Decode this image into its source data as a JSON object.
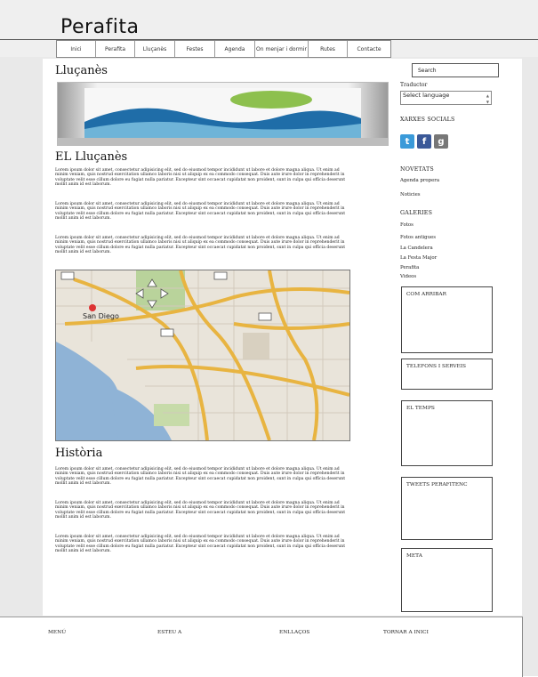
{
  "site": {
    "title": "Perafita"
  },
  "nav": {
    "items": [
      {
        "label": "Inici"
      },
      {
        "label": "Perafita"
      },
      {
        "label": "Lluçanès"
      },
      {
        "label": "Festes"
      },
      {
        "label": "Agenda"
      },
      {
        "label": "On menjar i dormir"
      },
      {
        "label": "Rutes"
      },
      {
        "label": "Contacte"
      }
    ]
  },
  "main": {
    "heading": "Lluçanès",
    "section1_title": "EL Lluçanès",
    "section2_title": "Història",
    "lorem": "Lorem ipsum dolor sit amet, consectetur adipisicing elit, sed do eiusmod tempor incididunt ut labore et dolore magna aliqua. Ut enim ad minim veniam, quis nostrud exercitation ullamco laboris nisi ut aliquip ex ea commodo consequat. Duis aute irure dolor in reprehenderit in voluptate velit esse cillum dolore eu fugiat nulla pariatur. Excepteur sint occaecat cupidatat non proident, sunt in culpa qui officia deserunt mollit anim id est laborum."
  },
  "map": {
    "city_label": "San Diego"
  },
  "sidebar": {
    "search_placeholder": "Search",
    "translator_label": "Traductor",
    "language_select": "Select language",
    "social_title": "XARXES SOCIALS",
    "social": [
      {
        "icon": "twitter-icon",
        "color": "#3a9ad9"
      },
      {
        "icon": "facebook-icon",
        "color": "#3b5998"
      },
      {
        "icon": "google-plus-icon",
        "color": "#777777"
      }
    ],
    "news_title": "NOVETATS",
    "news_items": [
      "Agenda propera",
      "Noticies"
    ],
    "galleries_title": "GALERIES",
    "gallery_items": [
      "Fotos",
      "Fotos antigues",
      "La Candelera",
      "La Festa Major",
      "Perafita",
      "Videos"
    ],
    "widgets": [
      "COM ARRIBAR",
      "TELEFONS I SERVEIS",
      "EL TEMPS",
      "TWEETS PERAFITENC",
      "META"
    ]
  },
  "footer": {
    "links": [
      "MENÚ",
      "ESTEU A",
      "ENLLAÇOS",
      "TORNAR A INICI"
    ]
  }
}
